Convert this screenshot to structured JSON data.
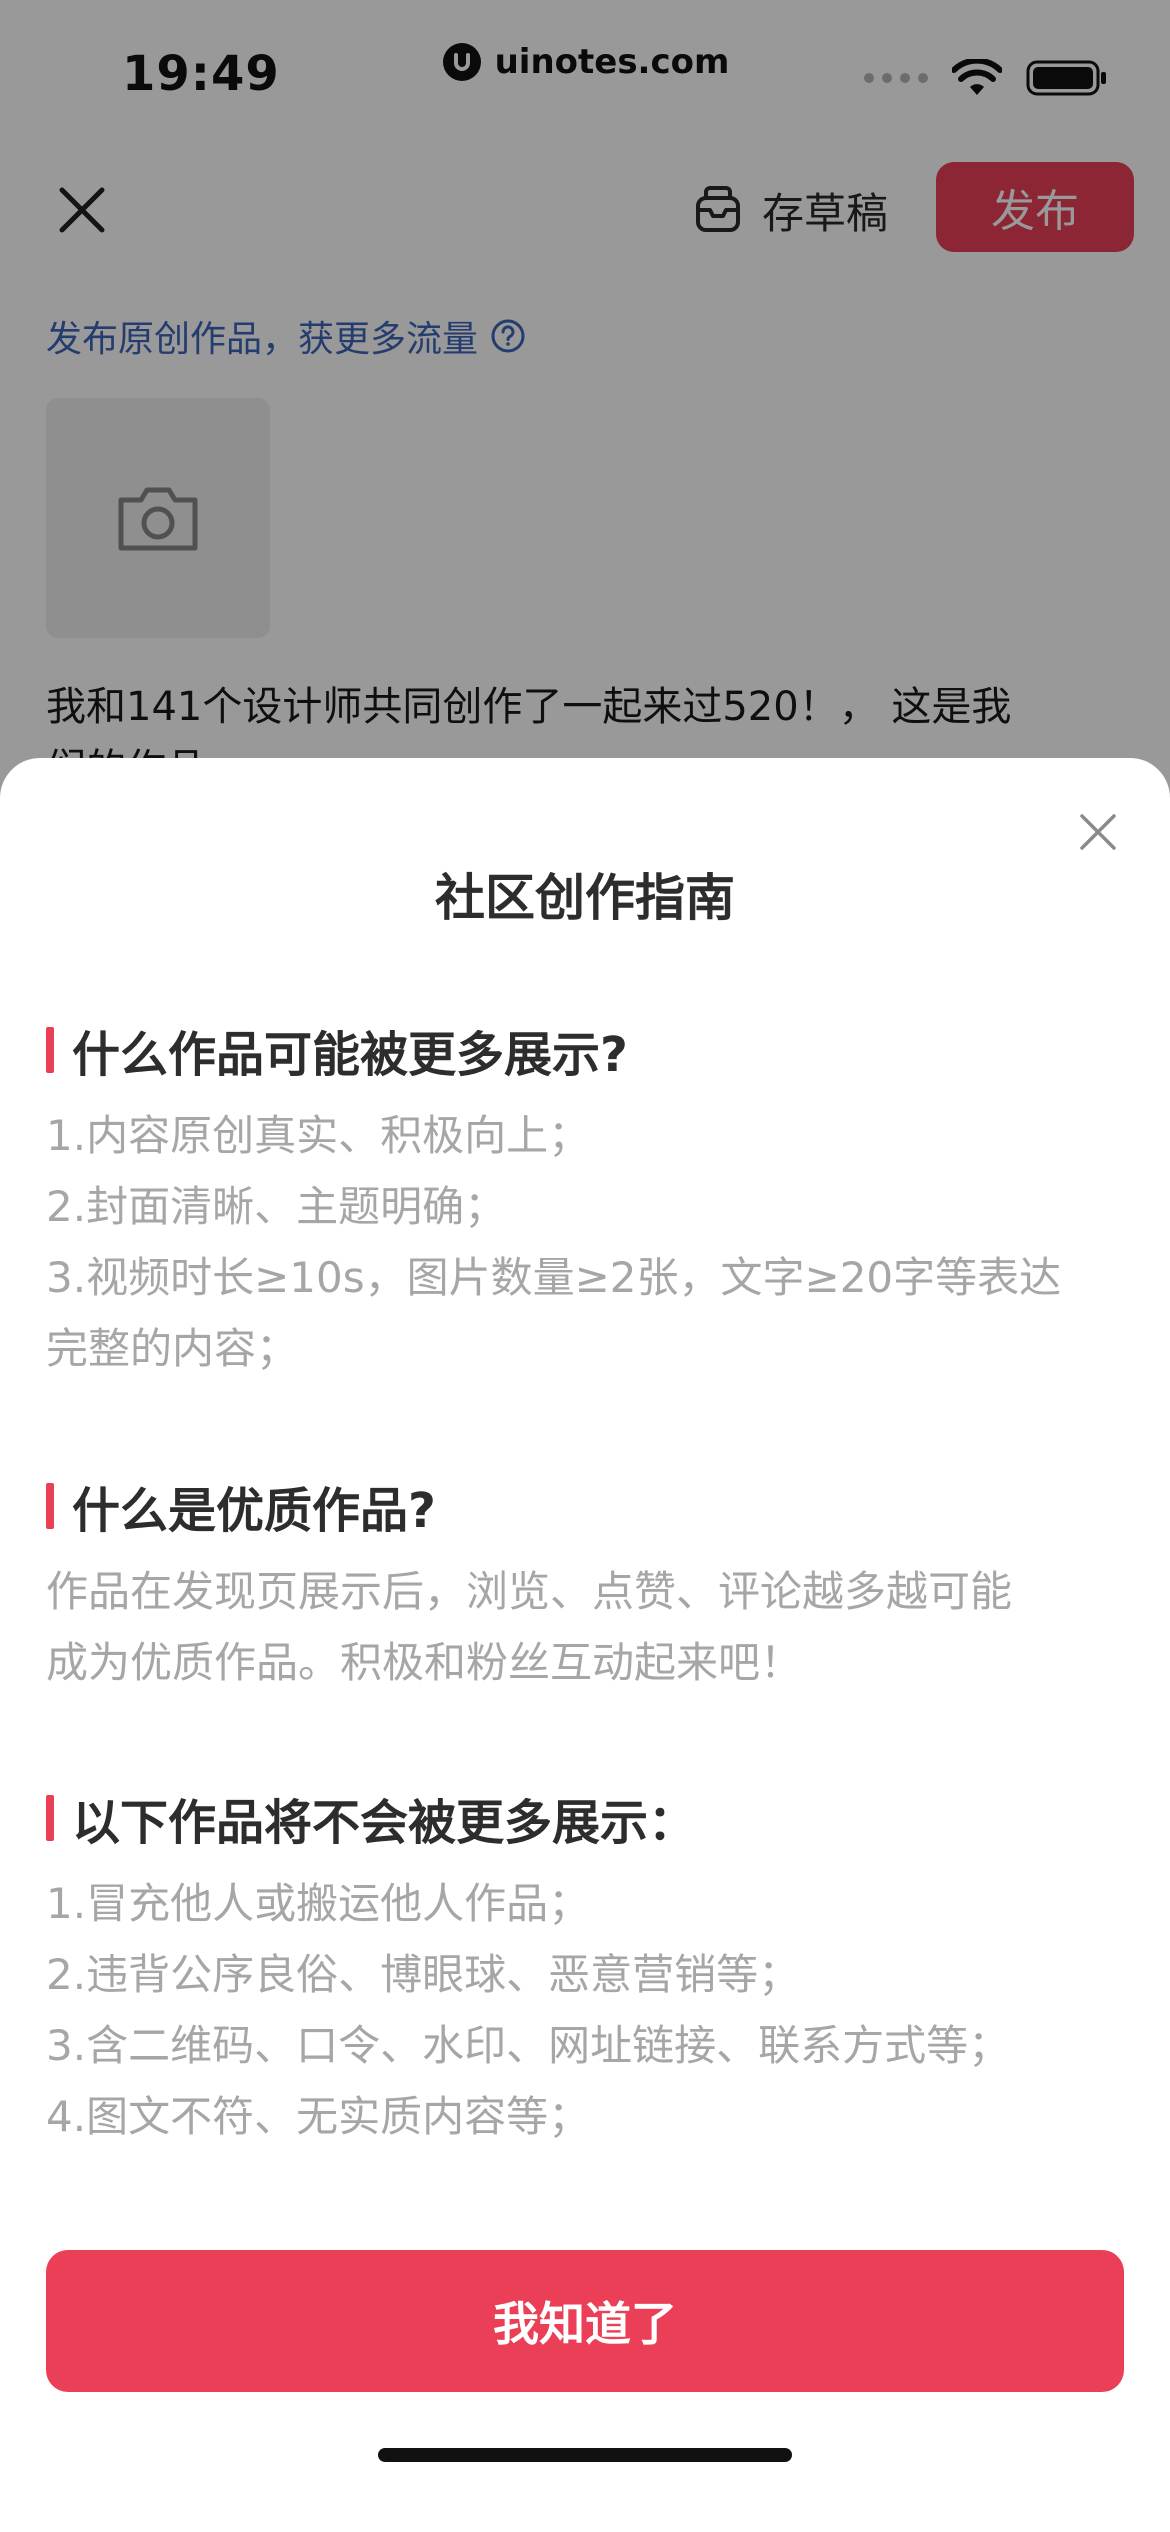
{
  "status_bar": {
    "time": "19:49",
    "url": "uinotes.com",
    "icons": [
      "signal-dots-icon",
      "wifi-icon",
      "battery-icon"
    ]
  },
  "composer": {
    "draft_label": "存草稿",
    "publish_label": "发布",
    "promo_text": "发布原创作品，获更多流量",
    "caption_line1": "我和141个设计师共同创作了一起来过520！， 这是我",
    "caption_line2": "们的作品",
    "icons": [
      "close-icon",
      "draft-box-icon",
      "help-circle-icon",
      "camera-icon"
    ]
  },
  "sheet": {
    "title": "社区创作指南",
    "sections": [
      {
        "title": "什么作品可能被更多展示?",
        "lines": [
          "1.内容原创真实、积极向上；",
          "2.封面清晰、主题明确；",
          "3.视频时长≥10s，图片数量≥2张，文字≥20字等表达",
          "完整的内容；"
        ]
      },
      {
        "title": "什么是优质作品?",
        "lines": [
          "作品在发现页展示后，浏览、点赞、评论越多越可能",
          "成为优质作品。积极和粉丝互动起来吧！"
        ]
      },
      {
        "title": "以下作品将不会被更多展示：",
        "lines": [
          "1.冒充他人或搬运他人作品；",
          "2.违背公序良俗、博眼球、恶意营销等；",
          "3.含二维码、口令、水印、网址链接、联系方式等；",
          "4.图文不符、无实质内容等；"
        ]
      }
    ],
    "confirm_label": "我知道了"
  },
  "colors": {
    "accent": "#ea3f57",
    "link": "#3f66b8",
    "muted_text": "#a6a6a6",
    "heading_text": "#2d2d2d"
  }
}
